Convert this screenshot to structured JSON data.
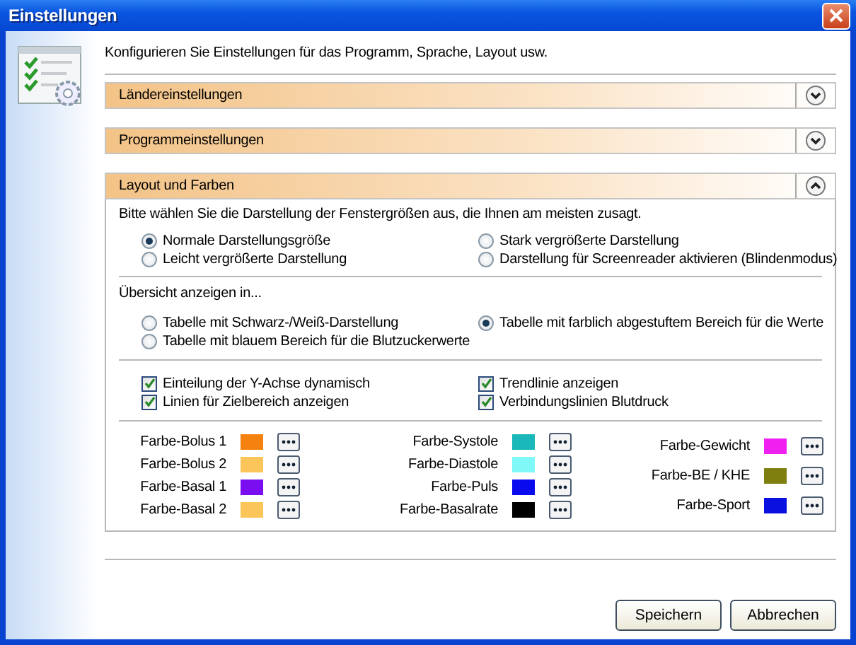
{
  "window": {
    "title": "Einstellungen"
  },
  "intro": "Konfigurieren Sie Einstellungen für das Programm, Sprache, Layout usw.",
  "sections": [
    {
      "title": "Ländereinstellungen",
      "expanded": false
    },
    {
      "title": "Programmeinstellungen",
      "expanded": false
    },
    {
      "title": "Layout und Farben",
      "expanded": true
    }
  ],
  "layout": {
    "size_prompt": "Bitte wählen Sie die Darstellung der Fenstergrößen aus, die Ihnen am meisten zusagt.",
    "size_options": [
      {
        "label": "Normale Darstellungsgröße",
        "selected": true
      },
      {
        "label": "Stark vergrößerte Darstellung",
        "selected": false
      },
      {
        "label": "Leicht vergrößerte Darstellung",
        "selected": false
      },
      {
        "label": "Darstellung für Screenreader aktivieren (Blindenmodus)",
        "selected": false
      }
    ],
    "overview_prompt": "Übersicht anzeigen in...",
    "overview_options": [
      {
        "label": "Tabelle mit Schwarz-/Weiß-Darstellung",
        "selected": false
      },
      {
        "label": "Tabelle mit farblich abgestuftem Bereich für die Werte",
        "selected": true
      },
      {
        "label": "Tabelle mit blauem Bereich für die Blutzuckerwerte",
        "selected": false
      }
    ],
    "checkboxes": [
      {
        "label": "Einteilung der Y-Achse dynamisch",
        "checked": true
      },
      {
        "label": "Trendlinie anzeigen",
        "checked": true
      },
      {
        "label": "Linien für Zielbereich anzeigen",
        "checked": true
      },
      {
        "label": "Verbindungslinien Blutdruck",
        "checked": true
      }
    ],
    "color_columns": [
      [
        {
          "label": "Farbe-Bolus 1",
          "color": "#f5820f"
        },
        {
          "label": "Farbe-Bolus 2",
          "color": "#fbc55a"
        },
        {
          "label": "Farbe-Basal 1",
          "color": "#7a0ef0"
        },
        {
          "label": "Farbe-Basal 2",
          "color": "#fbc55a"
        }
      ],
      [
        {
          "label": "Farbe-Systole",
          "color": "#1ab8b8"
        },
        {
          "label": "Farbe-Diastole",
          "color": "#80f8f8"
        },
        {
          "label": "Farbe-Puls",
          "color": "#0a0aee"
        },
        {
          "label": "Farbe-Basalrate",
          "color": "#000000"
        }
      ],
      [
        {
          "label": "Farbe-Gewicht",
          "color": "#f020f0"
        },
        {
          "label": "Farbe-BE / KHE",
          "color": "#7f7f10"
        },
        {
          "label": "Farbe-Sport",
          "color": "#0a10e0"
        }
      ]
    ]
  },
  "buttons": [
    {
      "label": "Speichern"
    },
    {
      "label": "Abbrechen"
    }
  ]
}
